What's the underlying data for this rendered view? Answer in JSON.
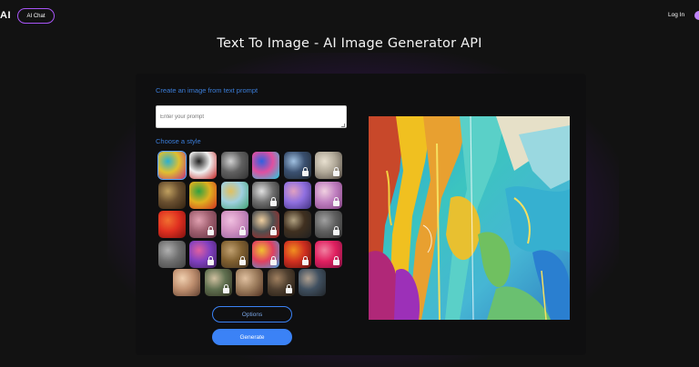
{
  "topbar": {
    "brand": "AI",
    "ai_chat_label": "AI Chat",
    "login_label": "Log In"
  },
  "page_title": "Text To Image - AI Image Generator API",
  "form": {
    "prompt_label": "Create an image from text prompt",
    "prompt_placeholder": "Enter your prompt",
    "style_label": "Choose a style",
    "options_label": "Options",
    "generate_label": "Generate"
  },
  "styles": [
    {
      "name": "style-colorful-abstract",
      "locked": false,
      "selected": true
    },
    {
      "name": "style-panda",
      "locked": false
    },
    {
      "name": "style-misty-forest",
      "locked": false
    },
    {
      "name": "style-neon-robot",
      "locked": false
    },
    {
      "name": "style-portrait-blue",
      "locked": true
    },
    {
      "name": "style-sketch",
      "locked": true
    },
    {
      "name": "style-mona-lisa",
      "locked": false
    },
    {
      "name": "style-fruit",
      "locked": false
    },
    {
      "name": "style-watercolor",
      "locked": false
    },
    {
      "name": "style-metallic-swirl",
      "locked": true
    },
    {
      "name": "style-isometric",
      "locked": false
    },
    {
      "name": "style-pink-room",
      "locked": true
    },
    {
      "name": "style-red-figure",
      "locked": false
    },
    {
      "name": "style-blurred-portrait",
      "locked": true
    },
    {
      "name": "style-pastel",
      "locked": true
    },
    {
      "name": "style-marilyn",
      "locked": true
    },
    {
      "name": "style-architecture",
      "locked": false
    },
    {
      "name": "style-grayscale",
      "locked": true
    },
    {
      "name": "style-blur-gray",
      "locked": false
    },
    {
      "name": "style-purple-blur",
      "locked": true
    },
    {
      "name": "style-brown-blur",
      "locked": true
    },
    {
      "name": "style-icons-grid",
      "locked": true
    },
    {
      "name": "style-fire",
      "locked": true
    },
    {
      "name": "style-red-pink",
      "locked": true
    },
    {
      "name": "style-portrait-warm",
      "locked": false
    },
    {
      "name": "style-portrait-green",
      "locked": true
    },
    {
      "name": "style-portrait-sepia",
      "locked": false
    },
    {
      "name": "style-portrait-hat",
      "locked": true
    },
    {
      "name": "style-portrait-dark",
      "locked": false
    }
  ],
  "colors": {
    "accent": "#3b82f6",
    "label": "#3b7dd8",
    "chat_border": "#a855f7"
  }
}
